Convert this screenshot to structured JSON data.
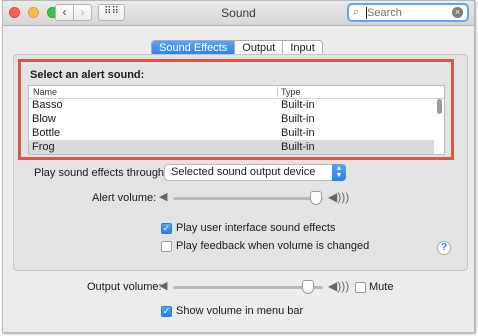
{
  "window": {
    "title": "Sound"
  },
  "search": {
    "placeholder": "Search"
  },
  "tabs": [
    {
      "label": "Sound Effects",
      "selected": true
    },
    {
      "label": "Output",
      "selected": false
    },
    {
      "label": "Input",
      "selected": false
    }
  ],
  "alert": {
    "title": "Select an alert sound:",
    "columns": [
      "Name",
      "Type"
    ],
    "rows": [
      {
        "name": "Basso",
        "type": "Built-in"
      },
      {
        "name": "Blow",
        "type": "Built-in"
      },
      {
        "name": "Bottle",
        "type": "Built-in"
      },
      {
        "name": "Frog",
        "type": "Built-in",
        "selected": true
      }
    ]
  },
  "play_through": {
    "label": "Play sound effects through:",
    "value": "Selected sound output device"
  },
  "alert_volume": {
    "label": "Alert volume:",
    "level_fraction": 0.95
  },
  "options": {
    "ui_sounds": {
      "label": "Play user interface sound effects",
      "checked": true
    },
    "feedback": {
      "label": "Play feedback when volume is changed",
      "checked": false
    }
  },
  "output_volume": {
    "label": "Output volume:",
    "level_fraction": 0.9
  },
  "mute": {
    "label": "Mute",
    "checked": false
  },
  "show_volume": {
    "label": "Show volume in menu bar",
    "checked": true
  },
  "icons": {
    "help": "?",
    "check": "✓"
  },
  "colors": {
    "accent": "#2a7ee3",
    "highlight_border": "#d95548"
  }
}
